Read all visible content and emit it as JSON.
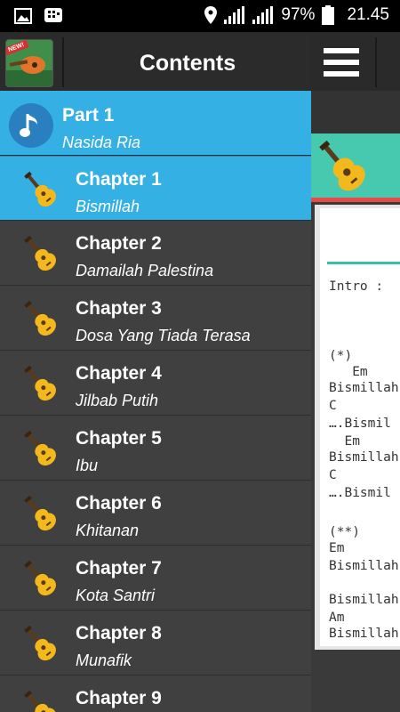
{
  "status_bar": {
    "battery": "97%",
    "time": "21.45",
    "icons": [
      "image-icon",
      "bbm-icon",
      "location-icon",
      "signal-icon",
      "signal-icon",
      "battery-icon"
    ]
  },
  "drawer": {
    "title": "Contents",
    "logo_badge": "NEW!",
    "part": {
      "title": "Part 1",
      "subtitle": "Nasida Ria"
    },
    "chapters": [
      {
        "title": "Chapter 1",
        "subtitle": "Bismillah",
        "selected": true
      },
      {
        "title": "Chapter 2",
        "subtitle": "Damailah Palestina"
      },
      {
        "title": "Chapter 3",
        "subtitle": "Dosa Yang Tiada Terasa"
      },
      {
        "title": "Chapter 4",
        "subtitle": "Jilbab Putih"
      },
      {
        "title": "Chapter 5",
        "subtitle": "Ibu"
      },
      {
        "title": "Chapter 6",
        "subtitle": "Khitanan"
      },
      {
        "title": "Chapter 7",
        "subtitle": "Kota Santri"
      },
      {
        "title": "Chapter 8",
        "subtitle": "Munafik"
      },
      {
        "title": "Chapter 9",
        "subtitle": ""
      }
    ]
  },
  "background_content": {
    "lines": [
      "Intro : ",
      "(*)",
      "   Em",
      "Bismillah",
      "C",
      "….Bismil",
      "  Em",
      "Bismillah",
      "C",
      "….Bismil",
      "(**)",
      "Em",
      "Bismillah",
      "Bismillah",
      "Am",
      "Bismillah"
    ]
  },
  "colors": {
    "accent": "#35b0e4",
    "drawer_bg": "#404040",
    "header_bg": "#2b2b2b",
    "teal": "#47c9b0"
  }
}
